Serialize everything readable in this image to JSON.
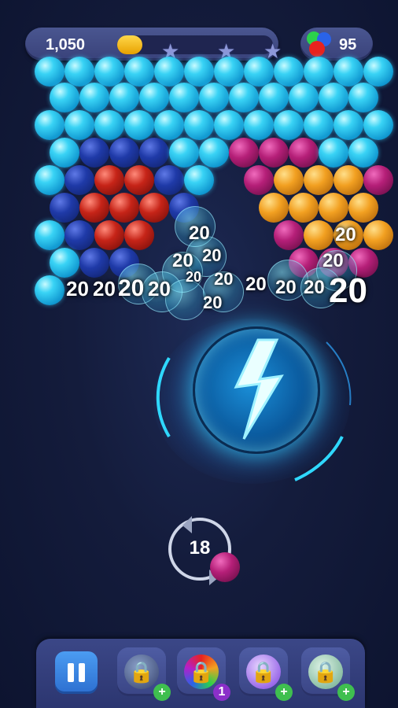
{
  "hud": {
    "score": "1,050",
    "progress": 0.12,
    "stars": [
      "★",
      "★",
      "★"
    ],
    "balls_remaining": "95"
  },
  "popups": {
    "values": [
      "20",
      "20",
      "20",
      "20",
      "20",
      "20",
      "20",
      "20",
      "20",
      "20",
      "20",
      "20",
      "20",
      "20",
      "20",
      "20"
    ]
  },
  "shooter": {
    "shots_left": "18",
    "current_ball_color": "magenta"
  },
  "boosters": [
    {
      "name": "booster-1",
      "badge": "+",
      "badge_color": "#3fbf4f"
    },
    {
      "name": "booster-2",
      "badge": "1",
      "badge_color": "#8b2fc9"
    },
    {
      "name": "booster-3",
      "badge": "+",
      "badge_color": "#3fbf4f"
    },
    {
      "name": "booster-4",
      "badge": "+",
      "badge_color": "#3fbf4f"
    }
  ],
  "icons": {
    "pause": "pause-icon",
    "lock": "lock-icon",
    "star": "star-icon",
    "balls": "colored-balls-icon",
    "lightning": "lightning-icon"
  }
}
